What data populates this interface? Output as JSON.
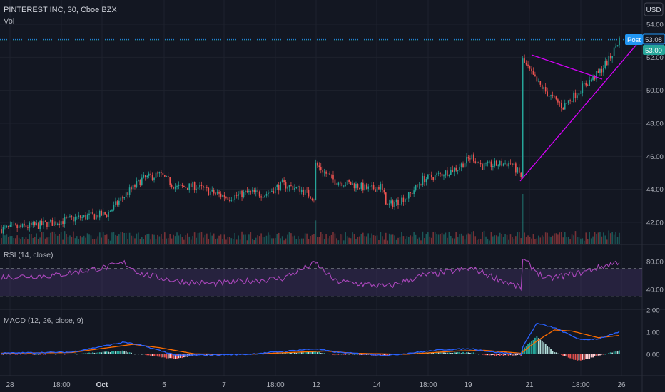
{
  "header": {
    "symbol": "PINTEREST INC, 30, Cboe BZX",
    "volume_label": "Vol",
    "currency_button": "USD"
  },
  "price_tags": {
    "post_label": "Post",
    "post_price": "53.08",
    "last_price": "53.00"
  },
  "colors": {
    "background": "#131722",
    "up": "#26a69a",
    "down": "#ef5350",
    "trendline": "#d500f9",
    "rsi": "#ab47bc",
    "macd": "#2962ff",
    "signal": "#ff6d00",
    "post_tag": "#2196f3"
  },
  "chart_data": [
    {
      "type": "candlestick",
      "title": "PINTEREST INC, 30, Cboe BZX",
      "y_ticks": [
        "54.00",
        "52.00",
        "50.00",
        "48.00",
        "46.00",
        "44.00",
        "42.00"
      ],
      "ylim": [
        41.3,
        54.8
      ],
      "x_ticks": [
        "28",
        "18:00",
        "Oct",
        "5",
        "7",
        "18:00",
        "12",
        "14",
        "18:00",
        "19",
        "21",
        "18:00",
        "26"
      ],
      "anchors": [
        [
          0,
          41.6
        ],
        [
          20,
          41.8
        ],
        [
          45,
          42.3
        ],
        [
          60,
          42.5
        ],
        [
          70,
          43.6
        ],
        [
          80,
          44.6
        ],
        [
          90,
          44.9
        ],
        [
          100,
          44.1
        ],
        [
          110,
          44.2
        ],
        [
          120,
          43.8
        ],
        [
          130,
          43.5
        ],
        [
          140,
          43.8
        ],
        [
          150,
          43.7
        ],
        [
          160,
          44.3
        ],
        [
          170,
          44.0
        ],
        [
          178,
          43.5
        ],
        [
          179,
          45.5
        ],
        [
          190,
          44.5
        ],
        [
          200,
          44.3
        ],
        [
          210,
          44.0
        ],
        [
          216,
          44.2
        ],
        [
          220,
          43.0
        ],
        [
          232,
          43.6
        ],
        [
          240,
          44.6
        ],
        [
          250,
          44.9
        ],
        [
          260,
          45.3
        ],
        [
          268,
          46.0
        ],
        [
          274,
          45.4
        ],
        [
          282,
          45.5
        ],
        [
          290,
          45.6
        ],
        [
          296,
          44.8
        ],
        [
          297,
          51.8
        ],
        [
          305,
          50.5
        ],
        [
          312,
          49.7
        ],
        [
          320,
          49.0
        ],
        [
          332,
          50.3
        ],
        [
          340,
          51.0
        ],
        [
          347,
          52.0
        ],
        [
          352,
          53.1
        ]
      ],
      "annotations": [
        "triangle pattern trendlines"
      ]
    },
    {
      "type": "bar",
      "title": "Vol",
      "note": "volume histogram, colored by candle direction"
    },
    {
      "type": "line",
      "title": "RSI (14, close)",
      "y_ticks": [
        "80.00",
        "40.00"
      ],
      "ylim": [
        20,
        90
      ],
      "band": [
        30,
        70
      ],
      "anchors": [
        [
          0,
          58
        ],
        [
          30,
          60
        ],
        [
          60,
          72
        ],
        [
          70,
          78
        ],
        [
          80,
          62
        ],
        [
          100,
          52
        ],
        [
          120,
          48
        ],
        [
          160,
          56
        ],
        [
          179,
          78
        ],
        [
          190,
          52
        ],
        [
          220,
          44
        ],
        [
          240,
          60
        ],
        [
          268,
          70
        ],
        [
          280,
          58
        ],
        [
          296,
          42
        ],
        [
          297,
          83
        ],
        [
          310,
          55
        ],
        [
          330,
          64
        ],
        [
          352,
          80
        ]
      ]
    },
    {
      "type": "line",
      "title": "MACD (12, 26, close, 9)",
      "y_ticks": [
        "2.00",
        "1.00",
        "0.00"
      ],
      "ylim": [
        -0.5,
        2.1
      ],
      "series": [
        {
          "name": "MACD",
          "anchors": [
            [
              0,
              0.05
            ],
            [
              40,
              0.1
            ],
            [
              70,
              0.55
            ],
            [
              80,
              0.4
            ],
            [
              100,
              -0.05
            ],
            [
              140,
              0.0
            ],
            [
              179,
              0.25
            ],
            [
              190,
              0.1
            ],
            [
              220,
              -0.05
            ],
            [
              250,
              0.2
            ],
            [
              268,
              0.25
            ],
            [
              280,
              0.1
            ],
            [
              296,
              0.0
            ],
            [
              297,
              0.35
            ],
            [
              305,
              1.4
            ],
            [
              315,
              1.2
            ],
            [
              330,
              0.65
            ],
            [
              340,
              0.7
            ],
            [
              352,
              1.0
            ]
          ]
        },
        {
          "name": "Signal",
          "anchors": [
            [
              0,
              0.05
            ],
            [
              40,
              0.08
            ],
            [
              75,
              0.45
            ],
            [
              90,
              0.3
            ],
            [
              110,
              0.02
            ],
            [
              140,
              0.0
            ],
            [
              185,
              0.15
            ],
            [
              200,
              0.05
            ],
            [
              230,
              0.0
            ],
            [
              260,
              0.15
            ],
            [
              275,
              0.18
            ],
            [
              296,
              0.05
            ],
            [
              305,
              0.6
            ],
            [
              315,
              1.1
            ],
            [
              325,
              1.05
            ],
            [
              340,
              0.75
            ],
            [
              352,
              0.85
            ]
          ]
        }
      ]
    }
  ]
}
